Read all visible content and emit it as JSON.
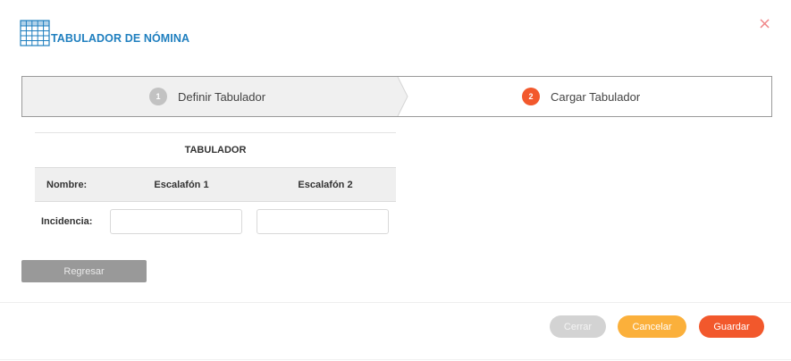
{
  "dialog": {
    "title": "TABULADOR DE NÓMINA",
    "icon": "table-grid-icon",
    "close_icon": "close-icon",
    "close_symbol": "×"
  },
  "wizard": {
    "steps": [
      {
        "number": "1",
        "label": "Definir Tabulador",
        "state": "completed"
      },
      {
        "number": "2",
        "label": "Cargar Tabulador",
        "state": "active"
      }
    ]
  },
  "tabulador": {
    "title": "TABULADOR",
    "columns": [
      "Nombre:",
      "Escalafón 1",
      "Escalafón 2"
    ],
    "row_label": "Incidencia:",
    "inputs": [
      {
        "value": "",
        "placeholder": ""
      },
      {
        "value": "",
        "placeholder": ""
      }
    ]
  },
  "buttons": {
    "regresar": "Regresar",
    "cerrar": "Cerrar",
    "cancelar": "Cancelar",
    "guardar": "Guardar"
  },
  "colors": {
    "title_blue": "#1f7fbf",
    "accent_orange": "#f2582c",
    "cancel_yellow": "#fbb03b",
    "disabled_gray": "#d3d3d3",
    "close_red": "#f0888a"
  }
}
